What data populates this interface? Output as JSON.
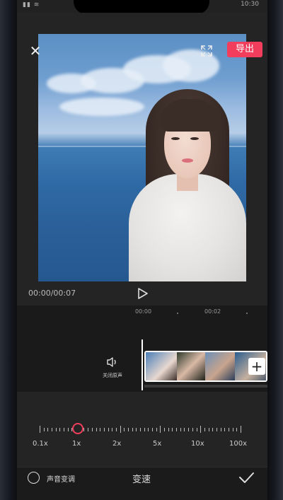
{
  "status_bar": {
    "time": "10:30"
  },
  "header": {
    "export_label": "导出",
    "close_icon": "close-icon",
    "fullscreen_icon": "fullscreen-icon"
  },
  "player": {
    "time": "00:00/00:07",
    "play_icon": "play-icon"
  },
  "timeline": {
    "ruler": [
      "00:00",
      "00:02"
    ],
    "mute_label": "关闭原声",
    "mute_icon": "speaker-icon",
    "add_icon": "plus-icon"
  },
  "speed": {
    "options": [
      "0.1x",
      "1x",
      "2x",
      "5x",
      "10x",
      "100x"
    ],
    "selected": "1x"
  },
  "bottom": {
    "pitch_label": "声音变调",
    "title": "变速",
    "confirm_icon": "check-icon"
  },
  "colors": {
    "accent": "#f23d5c",
    "background": "#242424"
  }
}
